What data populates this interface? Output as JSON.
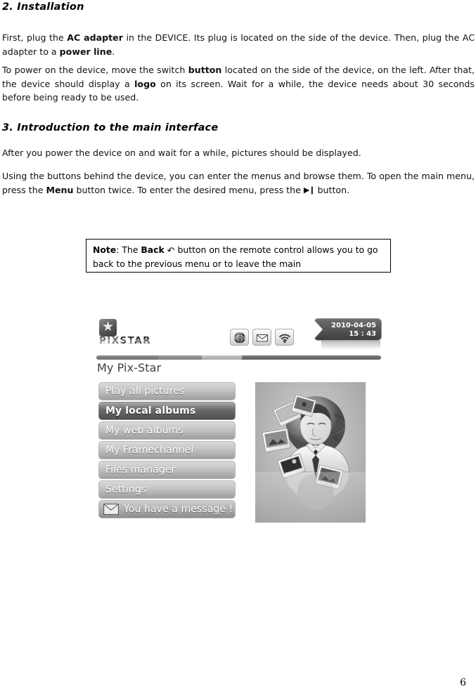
{
  "document": {
    "page_number": "6"
  },
  "sections": [
    {
      "heading": "2. Installation",
      "paragraphs": [
        {
          "parts": [
            {
              "text": "First, plug the "
            },
            {
              "text": "AC adapter",
              "bold": true
            },
            {
              "text": " in the DEVICE. Its plug is located on the side of the device. Then, plug the AC adapter to a "
            },
            {
              "text": "power line",
              "bold": true
            },
            {
              "text": "."
            }
          ]
        },
        {
          "parts": [
            {
              "text": "To power on the device, move the switch "
            },
            {
              "text": "button",
              "bold": true
            },
            {
              "text": " located on the side of the device, on the left. After that, the device should display a "
            },
            {
              "text": "logo",
              "bold": true
            },
            {
              "text": " on its screen. Wait for a while, the device needs about 30 seconds before being ready to be used."
            }
          ]
        }
      ]
    },
    {
      "heading": "3. Introduction to the main interface",
      "paragraphs": [
        {
          "parts": [
            {
              "text": "After you power the device on and wait for a while, pictures should be displayed."
            }
          ]
        },
        {
          "parts": [
            {
              "text": "Using the buttons behind the device, you can enter the menus and browse them. To open the main menu, press the "
            },
            {
              "text": "Menu",
              "bold": true
            },
            {
              "text": " button twice. To enter the desired menu, press the "
            },
            {
              "glyph": "play-pause-icon",
              "char": "▶❙"
            },
            {
              "text": " button."
            }
          ]
        }
      ]
    }
  ],
  "note_box": {
    "parts": [
      {
        "text": "Note",
        "bold": true
      },
      {
        "text": ": The "
      },
      {
        "text": "Back",
        "bold": true
      },
      {
        "text": " "
      },
      {
        "glyph": "back-arrow-icon",
        "char": "↶"
      },
      {
        "text": " button on the remote control allows you to go back to the previous menu or to leave the main"
      }
    ]
  },
  "device_screenshot": {
    "logo": {
      "brand_prefix": "PIX",
      "brand_suffix": "STAR",
      "badge_icon": "star-icon"
    },
    "status_icons": [
      {
        "name": "globe-icon",
        "label": "Network"
      },
      {
        "name": "mail-icon",
        "label": "Mail"
      },
      {
        "name": "wifi-icon",
        "label": "Wi-Fi"
      }
    ],
    "datetime": {
      "date": "2010-04-05",
      "time": "15 : 43"
    },
    "title": "My Pix-Star",
    "menu_items": [
      {
        "label": "Play all pictures",
        "selected": false,
        "icon": null
      },
      {
        "label": "My local albums",
        "selected": true,
        "icon": null
      },
      {
        "label": "My web albums",
        "selected": false,
        "icon": null
      },
      {
        "label": "My Framechannel",
        "selected": false,
        "icon": null
      },
      {
        "label": "Files manager",
        "selected": false,
        "icon": null
      },
      {
        "label": "Settings",
        "selected": false,
        "icon": null
      },
      {
        "label": "You have a message !",
        "selected": false,
        "icon": "envelope-icon"
      }
    ],
    "illustration": {
      "description": "Man with globe and floating photos"
    }
  },
  "colors": {
    "text": "#111111",
    "selected_menu_bg": "#5a5a5a",
    "menu_bg": "#c6c6c6",
    "datetime_bg": "#4f4f4f"
  }
}
